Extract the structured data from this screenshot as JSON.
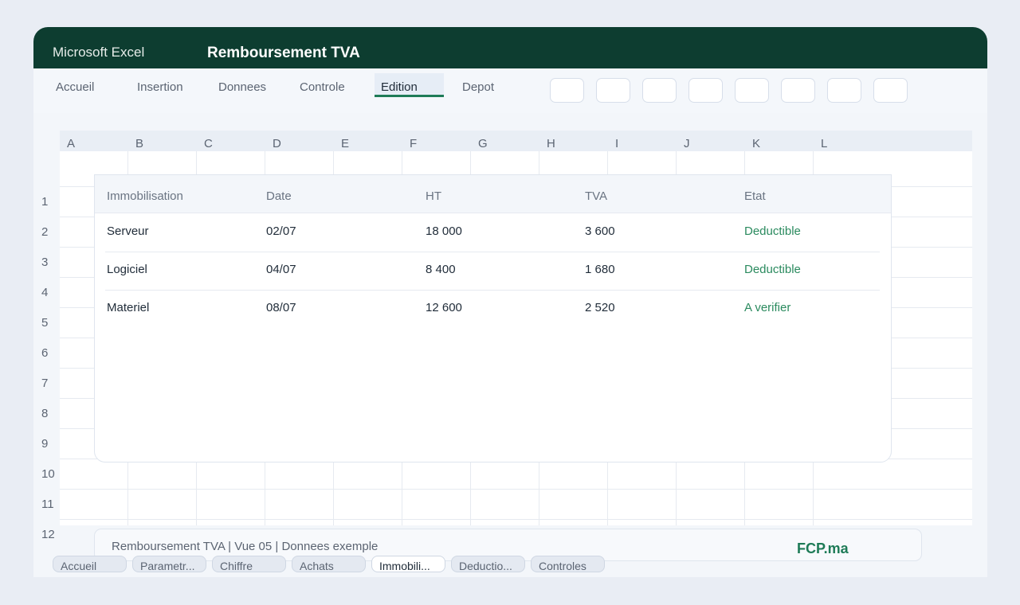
{
  "app": {
    "name": "Microsoft Excel",
    "title": "Remboursement TVA"
  },
  "ribbon": {
    "tabs": [
      "Accueil",
      "Insertion",
      "Donnees",
      "Controle",
      "Edition",
      "Depot"
    ],
    "active_tab": "Edition",
    "tool_buttons": 8
  },
  "sheet": {
    "columns": [
      "A",
      "B",
      "C",
      "D",
      "E",
      "F",
      "G",
      "H",
      "I",
      "J",
      "K",
      "L"
    ],
    "rows": [
      "1",
      "2",
      "3",
      "4",
      "5",
      "6",
      "7",
      "8",
      "9",
      "10",
      "11",
      "12"
    ]
  },
  "table": {
    "headers": [
      "Immobilisation",
      "Date",
      "HT",
      "TVA",
      "Etat"
    ],
    "rows": [
      [
        "Serveur",
        "02/07",
        "18 000",
        "3 600",
        "Deductible"
      ],
      [
        "Logiciel",
        "04/07",
        "8 400",
        "1 680",
        "Deductible"
      ],
      [
        "Materiel",
        "08/07",
        "12 600",
        "2 520",
        "A verifier"
      ]
    ]
  },
  "status": {
    "text": "Remboursement TVA | Vue 05 | Donnees exemple",
    "brand": "FCP.ma"
  },
  "sheet_tabs": [
    "Accueil",
    "Parametr...",
    "Chiffre",
    "Achats",
    "Immobili...",
    "Deductio...",
    "Controles"
  ],
  "active_sheet_tab": "Immobili...",
  "colors": {
    "titlebar": "#0d3d30",
    "accent": "#1e7b57",
    "state": "#2a8a5e"
  }
}
